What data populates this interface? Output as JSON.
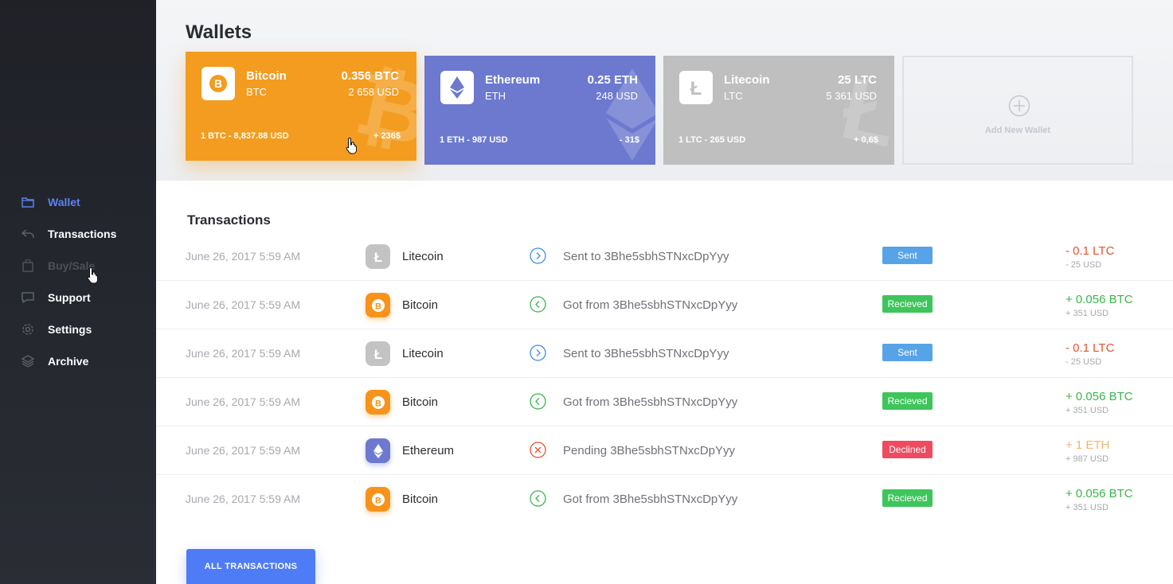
{
  "sidebar": {
    "items": [
      {
        "label": "Wallet",
        "icon": "folder-icon",
        "state": "active"
      },
      {
        "label": "Transactions",
        "icon": "reply-arrow-icon",
        "state": "normal"
      },
      {
        "label": "Buy/Sale",
        "icon": "shopping-bag-icon",
        "state": "disabled"
      },
      {
        "label": "Support",
        "icon": "chat-icon",
        "state": "normal"
      },
      {
        "label": "Settings",
        "icon": "gear-icon",
        "state": "normal"
      },
      {
        "label": "Archive",
        "icon": "layers-icon",
        "state": "normal"
      }
    ],
    "active_color": "#5b82f0"
  },
  "header": {
    "title": "Wallets"
  },
  "wallets": [
    {
      "name": "Bitcoin",
      "symbol": "BTC",
      "amount": "0.356 BTC",
      "usd": "2 658 USD",
      "rate": "1 BTC - 8,837.88 USD",
      "change": "+ 236$",
      "color": "#f39c1f"
    },
    {
      "name": "Ethereum",
      "symbol": "ETH",
      "amount": "0.25 ETH",
      "usd": "248 USD",
      "rate": "1 ETH - 987 USD",
      "change": "- 31$",
      "color": "#6c79cf"
    },
    {
      "name": "Litecoin",
      "symbol": "LTC",
      "amount": "25 LTC",
      "usd": "5 361 USD",
      "rate": "1 LTC - 265 USD",
      "change": "+ 0,6$",
      "color": "#bfbfbf"
    }
  ],
  "add_wallet": {
    "label": "Add New Wallet"
  },
  "transactions": {
    "title": "Transactions",
    "rows": [
      {
        "date": "June 26, 2017 5:59 AM",
        "coin": "Litecoin",
        "direction": "sent",
        "description": "Sent to 3Bhe5sbhSTNxcDpYyy",
        "status": "Sent",
        "amount": "- 0.1 LTC",
        "usd": "- 25 USD"
      },
      {
        "date": "June 26, 2017 5:59 AM",
        "coin": "Bitcoin",
        "direction": "received",
        "description": "Got from 3Bhe5sbhSTNxcDpYyy",
        "status": "Recieved",
        "amount": "+ 0.056 BTC",
        "usd": "+ 351 USD"
      },
      {
        "date": "June 26, 2017 5:59 AM",
        "coin": "Litecoin",
        "direction": "sent",
        "description": "Sent to 3Bhe5sbhSTNxcDpYyy",
        "status": "Sent",
        "amount": "- 0.1 LTC",
        "usd": "- 25 USD"
      },
      {
        "date": "June 26, 2017 5:59 AM",
        "coin": "Bitcoin",
        "direction": "received",
        "description": "Got from 3Bhe5sbhSTNxcDpYyy",
        "status": "Recieved",
        "amount": "+ 0.056 BTC",
        "usd": "+ 351 USD"
      },
      {
        "date": "June 26, 2017 5:59 AM",
        "coin": "Ethereum",
        "direction": "declined",
        "description": "Pending 3Bhe5sbhSTNxcDpYyy",
        "status": "Declined",
        "amount": "+ 1 ETH",
        "usd": "+ 987 USD"
      },
      {
        "date": "June 26, 2017 5:59 AM",
        "coin": "Bitcoin",
        "direction": "received",
        "description": "Got from 3Bhe5sbhSTNxcDpYyy",
        "status": "Recieved",
        "amount": "+ 0.056 BTC",
        "usd": "+ 351 USD"
      }
    ],
    "all_button": "ALL TRANSACTIONS"
  },
  "colors": {
    "btc": "#f39c1f",
    "eth": "#6c79cf",
    "ltc": "#c3c3c3",
    "sent_badge": "#57a3e8",
    "received_badge": "#3ec55b",
    "declined_badge": "#ef4b60",
    "negative_amount": "#e8522f",
    "positive_amount": "#3bb54a",
    "pending_amount": "#f3b66a",
    "primary_button": "#4e7cf6"
  }
}
